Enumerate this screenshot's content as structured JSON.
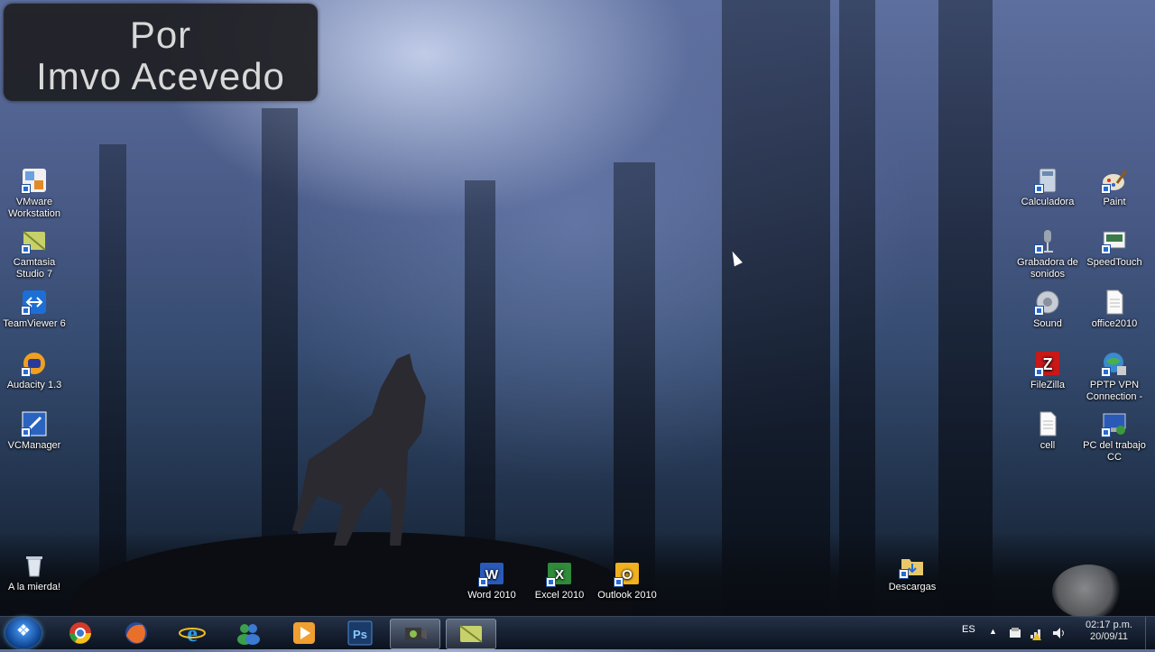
{
  "watermark": {
    "line1": "Por",
    "line2": "Imvo Acevedo"
  },
  "desktop_left": [
    {
      "label": "VMware Workstation",
      "icon": "vmware-icon"
    },
    {
      "label": "Camtasia Studio 7",
      "icon": "camtasia-icon"
    },
    {
      "label": "TeamViewer 6",
      "icon": "teamviewer-icon"
    },
    {
      "label": "Audacity 1.3",
      "icon": "audacity-icon"
    },
    {
      "label": "VCManager",
      "icon": "vcmanager-icon"
    },
    {
      "label": "A la mierda!",
      "icon": "recycle-bin-icon"
    }
  ],
  "desktop_bottom": [
    {
      "label": "Word 2010",
      "icon": "word-icon"
    },
    {
      "label": "Excel 2010",
      "icon": "excel-icon"
    },
    {
      "label": "Outlook 2010",
      "icon": "outlook-icon"
    },
    {
      "label": "Descargas",
      "icon": "downloads-folder-icon"
    }
  ],
  "desktop_right": [
    {
      "label": "Calculadora",
      "icon": "calculator-icon"
    },
    {
      "label": "Paint",
      "icon": "paint-icon"
    },
    {
      "label": "Grabadora de sonidos",
      "icon": "sound-recorder-icon"
    },
    {
      "label": "SpeedTouch",
      "icon": "speedtouch-icon"
    },
    {
      "label": "Sound",
      "icon": "sound-icon"
    },
    {
      "label": "office2010",
      "icon": "file-icon"
    },
    {
      "label": "FileZilla",
      "icon": "filezilla-icon"
    },
    {
      "label": "PPTP VPN Connection -",
      "icon": "vpn-icon"
    },
    {
      "label": "cell",
      "icon": "file-icon"
    },
    {
      "label": "PC del trabajo CC",
      "icon": "remote-desktop-icon"
    }
  ],
  "taskbar": {
    "pinned": [
      "chrome-icon",
      "firefox-icon",
      "internet-explorer-icon",
      "messenger-icon",
      "media-player-icon",
      "photoshop-icon",
      "camtasia-recorder-icon",
      "camtasia-studio-icon"
    ],
    "photoshop_label": "Ps",
    "language": "ES",
    "time": "02:17 p.m.",
    "date": "20/09/11"
  }
}
